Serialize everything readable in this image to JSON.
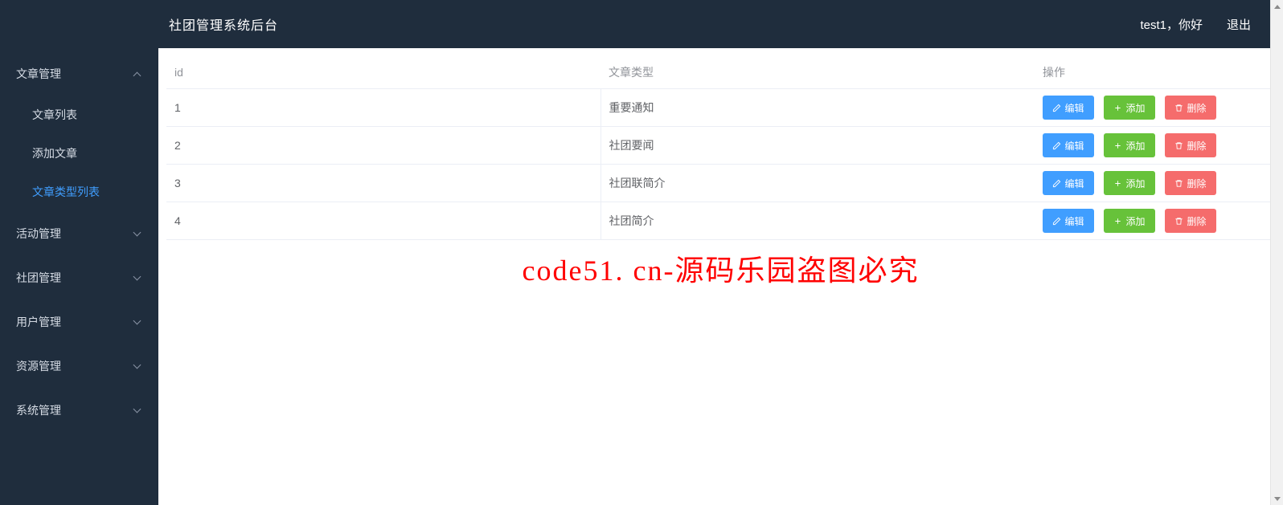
{
  "topbar": {
    "title": "社团管理系统后台",
    "greeting": "test1，你好",
    "logout": "退出"
  },
  "sidebar": {
    "groups": [
      {
        "label": "文章管理",
        "expanded": true,
        "items": [
          {
            "label": "文章列表",
            "active": false
          },
          {
            "label": "添加文章",
            "active": false
          },
          {
            "label": "文章类型列表",
            "active": true
          }
        ]
      },
      {
        "label": "活动管理",
        "expanded": false,
        "items": []
      },
      {
        "label": "社团管理",
        "expanded": false,
        "items": []
      },
      {
        "label": "用户管理",
        "expanded": false,
        "items": []
      },
      {
        "label": "资源管理",
        "expanded": false,
        "items": []
      },
      {
        "label": "系统管理",
        "expanded": false,
        "items": []
      }
    ]
  },
  "table": {
    "headers": {
      "id": "id",
      "type": "文章类型",
      "ops": "操作"
    },
    "rows": [
      {
        "id": "1",
        "type": "重要通知"
      },
      {
        "id": "2",
        "type": "社团要闻"
      },
      {
        "id": "3",
        "type": "社团联简介"
      },
      {
        "id": "4",
        "type": "社团简介"
      }
    ],
    "buttons": {
      "edit": "编辑",
      "add": "添加",
      "delete": "删除"
    }
  },
  "watermark": "code51. cn-源码乐园盗图必究"
}
